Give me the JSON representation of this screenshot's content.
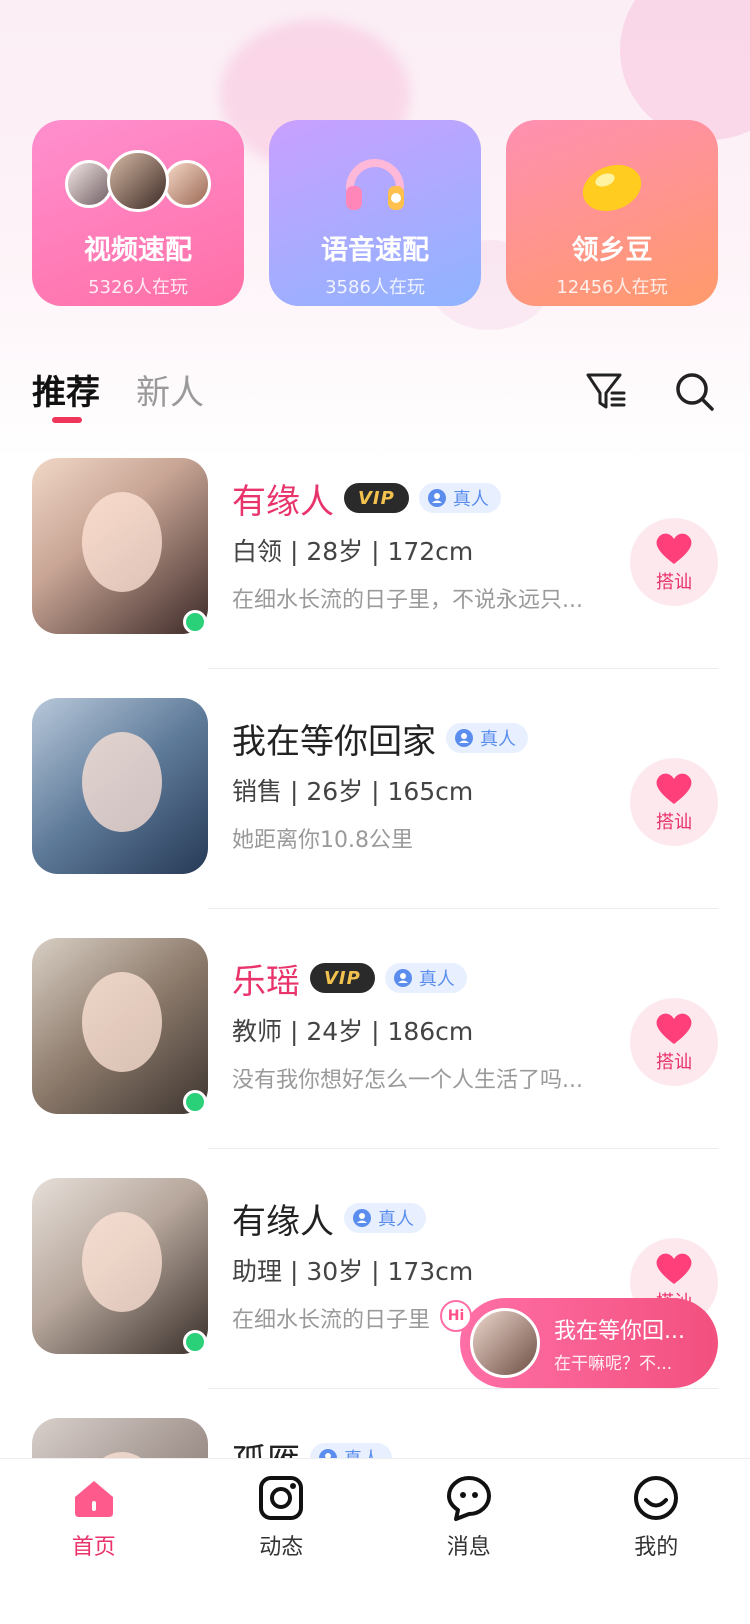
{
  "feature_cards": [
    {
      "title": "视频速配",
      "sub": "5326人在玩"
    },
    {
      "title": "语音速配",
      "sub": "3586人在玩"
    },
    {
      "title": "领乡豆",
      "sub": "12456人在玩"
    }
  ],
  "tabs": {
    "active": "推荐",
    "inactive": "新人"
  },
  "common": {
    "vip": "VIP",
    "real": "真人",
    "greet": "搭讪"
  },
  "users": [
    {
      "name": "有缘人",
      "meta": "白领 | 28岁 | 172cm",
      "bio": "在细水长流的日子里，不说永远只..."
    },
    {
      "name": "我在等你回家",
      "meta": "销售 | 26岁 | 165cm",
      "bio": "她距离你10.8公里"
    },
    {
      "name": "乐瑶",
      "meta": "教师 | 24岁 | 186cm",
      "bio": "没有我你想好怎么一个人生活了吗..."
    },
    {
      "name": "有缘人",
      "meta": "助理 | 30岁 | 173cm",
      "bio": "在细水长流的日子里"
    },
    {
      "name": "孤雁"
    }
  ],
  "chat_popup": {
    "hi": "Hi",
    "name": "我在等你回...",
    "message": "在干嘛呢？不..."
  },
  "bottom_nav": [
    {
      "label": "首页"
    },
    {
      "label": "动态"
    },
    {
      "label": "消息"
    },
    {
      "label": "我的"
    }
  ],
  "colors": {
    "accent": "#e9336b",
    "online": "#2ad178",
    "real_badge": "#5a8dee"
  }
}
